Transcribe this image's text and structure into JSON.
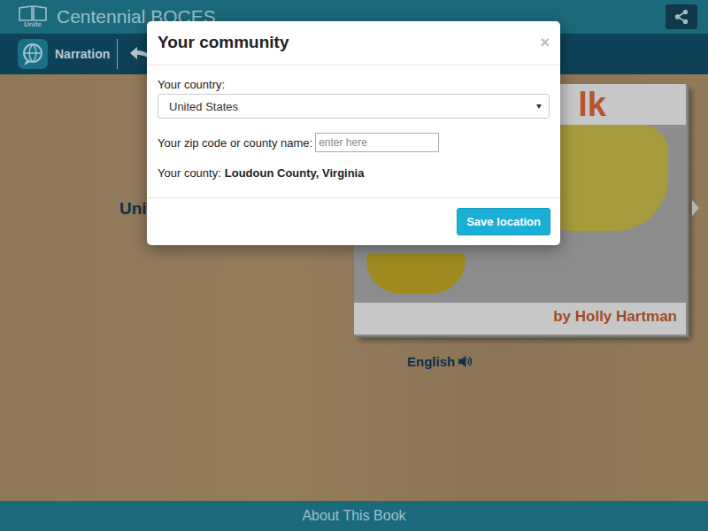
{
  "header": {
    "logo_text": "Unite",
    "title": "Centennial BOCES"
  },
  "toolbar": {
    "narration_label": "Narration"
  },
  "book": {
    "heading": "Unit",
    "cover_title": "lk",
    "cover_author": "by Holly Hartman",
    "language": "English"
  },
  "footer": {
    "label": "About This Book"
  },
  "dialog": {
    "title": "Your community",
    "close": "×",
    "country_label": "Your country:",
    "country_value": "United States",
    "zip_label": "Your zip code or county name:",
    "zip_placeholder": "enter here",
    "county_label": "Your county:",
    "county_value": "Loudoun County, Virginia",
    "save_button": "Save location"
  }
}
